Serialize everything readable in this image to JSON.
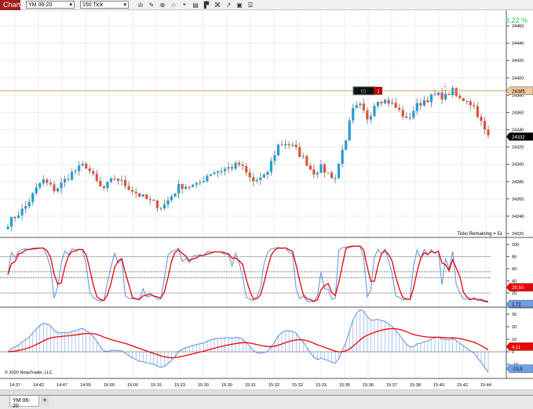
{
  "toolbar": {
    "chart_label": "Chart",
    "instrument": "YM 06-20",
    "interval": "150 Tick",
    "icons": [
      "bar-type-icon",
      "draw-icon",
      "zoom-in-icon",
      "zoom-out-icon",
      "crosshair-icon",
      "properties-icon",
      "strategy-icon",
      "indicators-icon",
      "templates-icon",
      "data-box-icon",
      "menu-icon"
    ]
  },
  "price_panel": {
    "percent_change": "3,22 %",
    "ticks_remaining": "Ticks Remaining = 51",
    "axis_labels": [
      "24460",
      "24440",
      "24420",
      "24400",
      "24380",
      "24360",
      "24340",
      "24320",
      "24300",
      "24280",
      "24260",
      "24240",
      "24220"
    ],
    "current_price": "24332",
    "position_line_price": "24385",
    "position_qty": "53",
    "position_size": "1",
    "price_path": [
      [
        0,
        24232
      ],
      [
        8,
        24250
      ],
      [
        16,
        24282
      ],
      [
        22,
        24270
      ],
      [
        30,
        24290
      ],
      [
        36,
        24300
      ],
      [
        44,
        24270
      ],
      [
        50,
        24285
      ],
      [
        58,
        24270
      ],
      [
        64,
        24260
      ],
      [
        72,
        24250
      ],
      [
        80,
        24275
      ],
      [
        88,
        24275
      ],
      [
        94,
        24290
      ],
      [
        102,
        24295
      ],
      [
        108,
        24300
      ],
      [
        114,
        24280
      ],
      [
        120,
        24285
      ],
      [
        126,
        24322
      ],
      [
        130,
        24325
      ],
      [
        134,
        24318
      ],
      [
        140,
        24300
      ],
      [
        142,
        24290
      ],
      [
        146,
        24296
      ],
      [
        150,
        24288
      ],
      [
        153,
        24284
      ],
      [
        156,
        24320
      ],
      [
        158,
        24325
      ],
      [
        160,
        24360
      ],
      [
        164,
        24368
      ],
      [
        168,
        24352
      ],
      [
        172,
        24376
      ],
      [
        178,
        24372
      ],
      [
        184,
        24358
      ],
      [
        186,
        24350
      ],
      [
        190,
        24366
      ],
      [
        194,
        24374
      ],
      [
        200,
        24380
      ],
      [
        204,
        24378
      ],
      [
        207,
        24386
      ],
      [
        210,
        24375
      ],
      [
        214,
        24375
      ],
      [
        218,
        24365
      ],
      [
        220,
        24352
      ],
      [
        222,
        24340
      ],
      [
        224,
        24332
      ]
    ],
    "colors": {
      "up": "#1e9ed8",
      "down": "#e0533a",
      "line": "#e0a060"
    }
  },
  "stoch_panel": {
    "axis_labels": [
      "100",
      "80",
      "60",
      "40",
      "20"
    ],
    "value_d": "29,50",
    "value_k": "1,72"
  },
  "macd_panel": {
    "axis_labels": [
      "30",
      "20",
      "10",
      "0",
      "-10"
    ],
    "value_avg": "4,11",
    "value_diff": "-13,5",
    "copyright": "© 2020 NinjaTrader, LLC"
  },
  "time_axis": [
    "14:37",
    "14:42",
    "14:47",
    "14:55",
    "15:00",
    "15:06",
    "15:15",
    "15:23",
    "15:30",
    "15:30",
    "15:31",
    "15:32",
    "15:32",
    "15:33",
    "15:35",
    "15:36",
    "15:37",
    "15:38",
    "15:40",
    "15:42",
    "15:44"
  ],
  "tabs": {
    "instrument_tab": "YM 06-20",
    "add_tab": "+"
  }
}
